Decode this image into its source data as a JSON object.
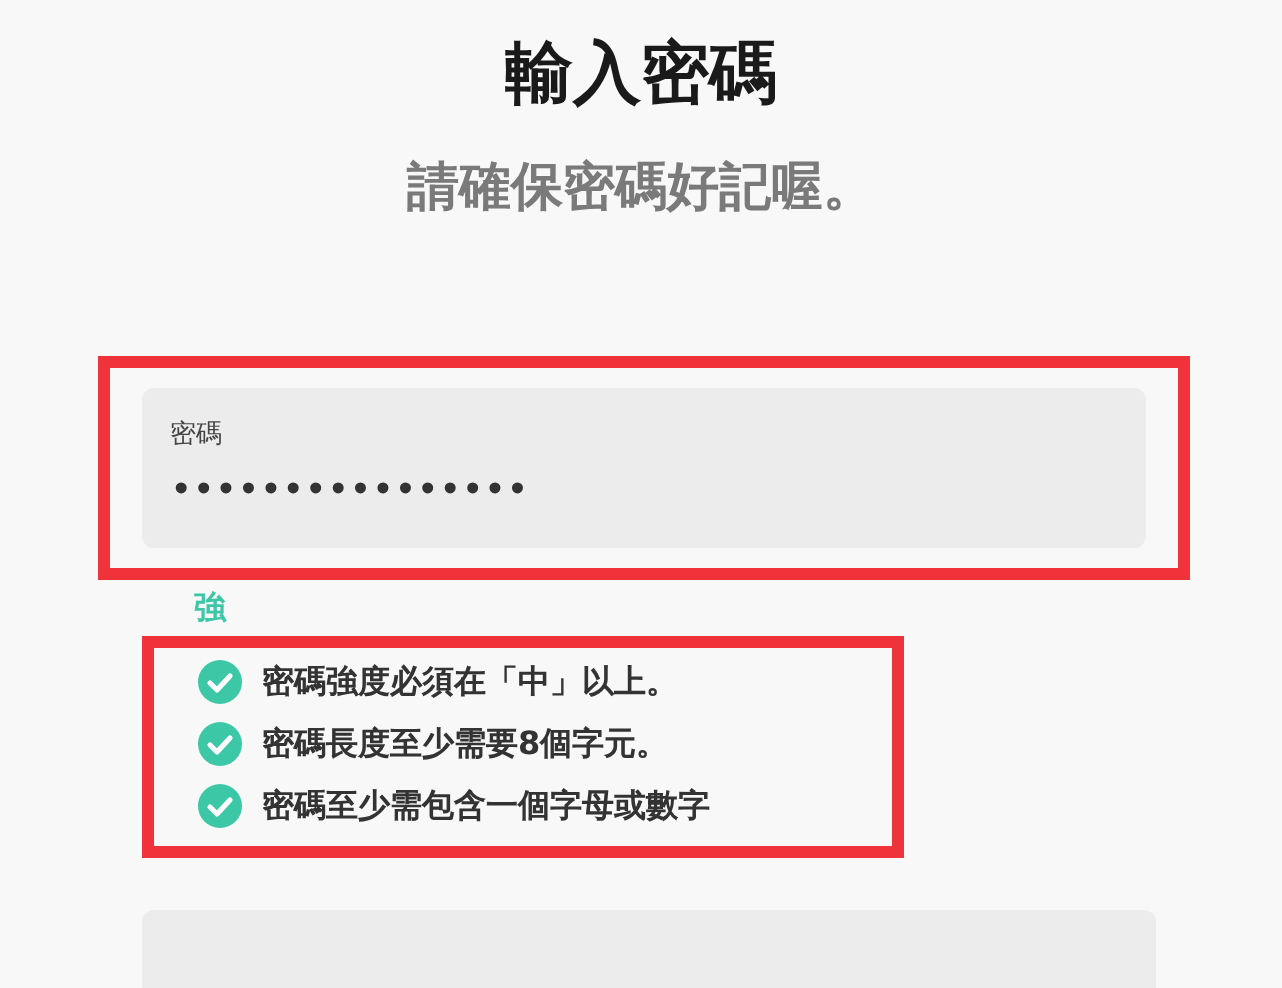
{
  "title": "輸入密碼",
  "subtitle": "請確保密碼好記喔。",
  "password_field": {
    "label": "密碼",
    "value": "••••••••••••••••"
  },
  "strength": {
    "label": "強",
    "color": "#3cc7a6"
  },
  "requirements": [
    {
      "text": "密碼強度必須在「中」以上。",
      "met": true
    },
    {
      "text": "密碼長度至少需要8個字元。",
      "met": true
    },
    {
      "text": "密碼至少需包含一個字母或數字",
      "met": true
    }
  ],
  "next_field": {
    "kind": "field"
  }
}
